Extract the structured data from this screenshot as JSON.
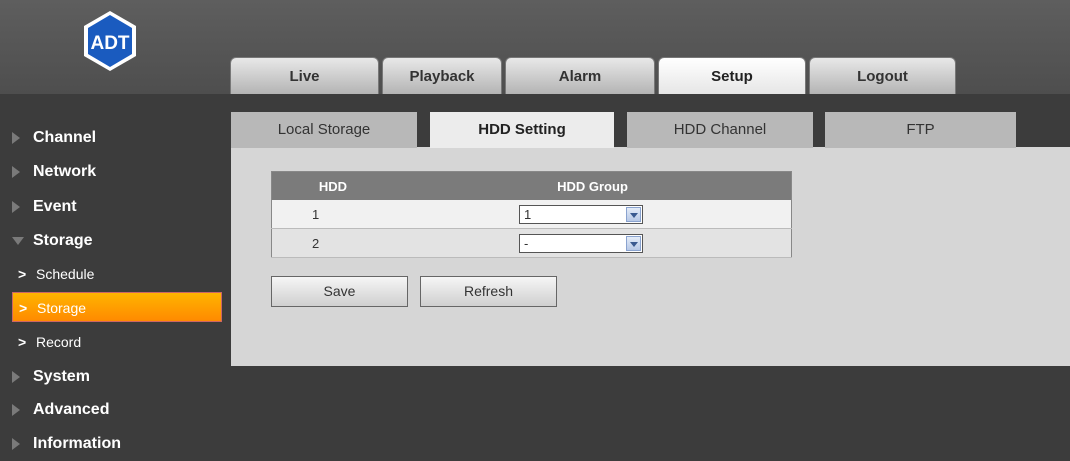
{
  "brand": {
    "logo_text": "ADT"
  },
  "top_nav": [
    {
      "label": "Live"
    },
    {
      "label": "Playback"
    },
    {
      "label": "Alarm"
    },
    {
      "label": "Setup"
    },
    {
      "label": "Logout"
    }
  ],
  "sidebar": {
    "channel": "Channel",
    "network": "Network",
    "event": "Event",
    "storage": "Storage",
    "sub": [
      "Schedule",
      "Storage",
      "Record"
    ],
    "system": "System",
    "advanced": "Advanced",
    "information": "Information"
  },
  "sub_tabs": [
    "Local Storage",
    "HDD Setting",
    "HDD Channel",
    "FTP"
  ],
  "table": {
    "headers": [
      "HDD",
      "HDD Group"
    ],
    "rows": [
      {
        "hdd": "1",
        "group": "1"
      },
      {
        "hdd": "2",
        "group": "-"
      }
    ]
  },
  "buttons": {
    "save": "Save",
    "refresh": "Refresh"
  },
  "colors": {
    "active_accent": "#ff9a00",
    "panel_bg": "#d6d6d6"
  }
}
